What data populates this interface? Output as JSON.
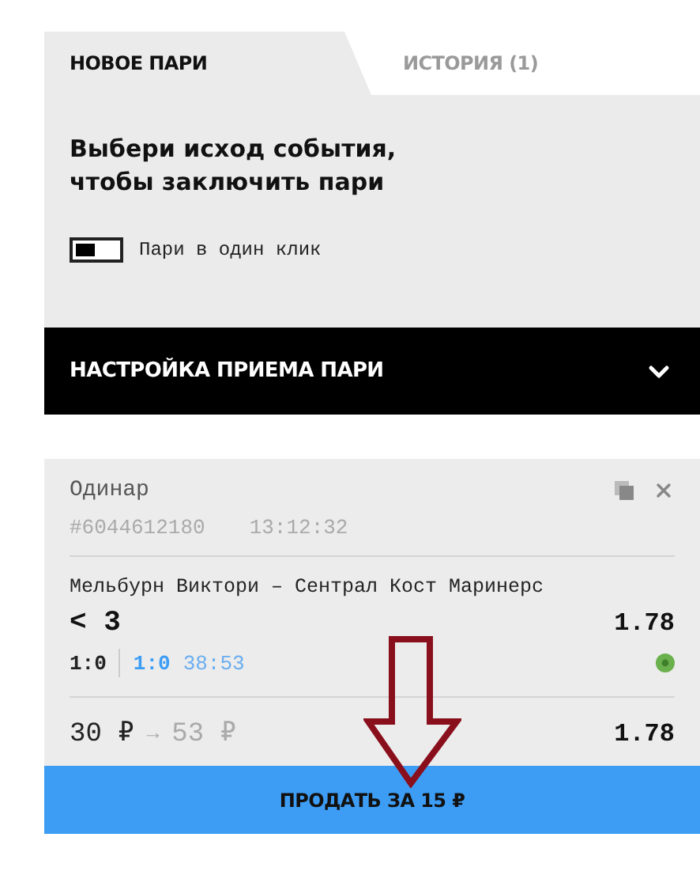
{
  "tabs": [
    {
      "label": "НОВОЕ ПАРИ",
      "selected": true
    },
    {
      "label": "ИСТОРИЯ (1)",
      "selected": false
    }
  ],
  "prompt": "Выбери исход события,\nчтобы заключить пари",
  "one_click": {
    "label": "Пари в один клик",
    "on": false
  },
  "settings_bar": {
    "title": "НАСТРОЙКА ПРИЕМА ПАРИ",
    "expanded": false
  },
  "ticket": {
    "type": "Одинар",
    "id": "#6044612180",
    "time": "13:12:32",
    "match": "Мельбурн Виктори – Сентрал Кост Маринерс",
    "outcome": "< 3",
    "odds": "1.78",
    "score": "1:0",
    "live_score": "1:0",
    "live_time": "38:53",
    "stake": "30 ₽",
    "arrow": "→",
    "payout": "53 ₽",
    "total_odds": "1.78",
    "sell_button": "ПРОДАТЬ ЗА 15 ₽"
  }
}
